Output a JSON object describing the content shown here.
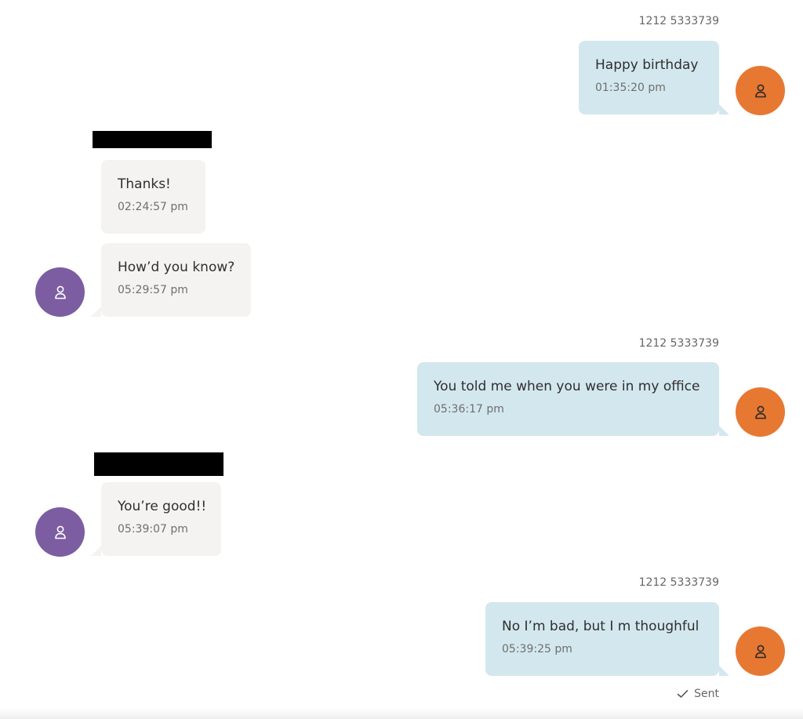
{
  "theme": {
    "outgoing_bubble": "#d3e7ee",
    "incoming_bubble": "#f4f3f2",
    "outgoing_avatar": "#e77832",
    "incoming_avatar": "#7c5da2",
    "redaction": "#000000"
  },
  "conversation": {
    "messages": [
      {
        "direction": "outgoing",
        "sender": "1212 5333739",
        "text": "Happy birthday",
        "time": "01:35:20 pm",
        "avatar_icon": "person-icon"
      },
      {
        "direction": "incoming",
        "sender_redacted": true,
        "text": "Thanks!",
        "time": "02:24:57 pm"
      },
      {
        "direction": "incoming",
        "text": "How’d you know?",
        "time": "05:29:57 pm",
        "avatar_icon": "person-icon"
      },
      {
        "direction": "outgoing",
        "sender": "1212 5333739",
        "text": "You told me when you were in my office",
        "time": "05:36:17 pm",
        "avatar_icon": "person-icon"
      },
      {
        "direction": "incoming",
        "sender_redacted": true,
        "text": "You’re good!!",
        "time": "05:39:07 pm",
        "avatar_icon": "person-icon"
      },
      {
        "direction": "outgoing",
        "sender": "1212 5333739",
        "text": "No I’m bad,  but I m thoughful",
        "time": "05:39:25 pm",
        "avatar_icon": "person-icon"
      }
    ],
    "delivery_status": {
      "icon": "checkmark-icon",
      "label": "Sent"
    }
  }
}
